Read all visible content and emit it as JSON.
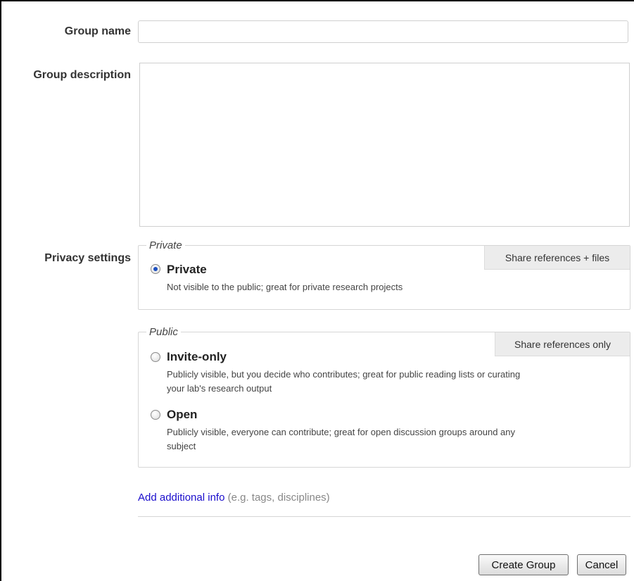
{
  "form": {
    "group_name_label": "Group name",
    "group_name_value": "",
    "group_description_label": "Group description",
    "group_description_value": "",
    "privacy_label": "Privacy settings"
  },
  "privacy": {
    "private_group": {
      "legend": "Private",
      "share_tag": "Share references + files",
      "options": [
        {
          "title": "Private",
          "description": "Not visible to the public; great for private research projects",
          "checked": true
        }
      ]
    },
    "public_group": {
      "legend": "Public",
      "share_tag": "Share references only",
      "options": [
        {
          "title": "Invite-only",
          "description_line1": "Publicly visible, but you decide who contributes; great for public reading lists or curating",
          "description_line2": "your lab's research output",
          "checked": false
        },
        {
          "title": "Open",
          "description_line1": "Publicly visible, everyone can contribute; great for open discussion groups around any",
          "description_line2": "subject",
          "checked": false
        }
      ]
    }
  },
  "additional": {
    "link_text": "Add additional info",
    "hint": "(e.g. tags, disciplines)"
  },
  "buttons": {
    "create_label": "Create Group",
    "cancel_label": "Cancel"
  },
  "colors": {
    "link": "#1a0dcc",
    "radio_dot": "#1c4fbf",
    "share_tag_bg": "#ececec"
  }
}
